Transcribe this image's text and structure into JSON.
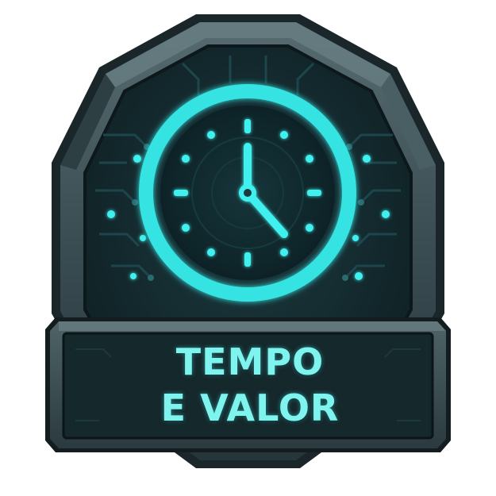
{
  "badge": {
    "title_line_1": "TEMPO",
    "title_line_2": "E VALOR",
    "icon": "clock-icon",
    "colors": {
      "frame": "#3d5257",
      "frame_dark": "#1d2b2f",
      "inner": "#14292d",
      "glow": "#33e0e0",
      "text": "#7ff3ee"
    }
  }
}
